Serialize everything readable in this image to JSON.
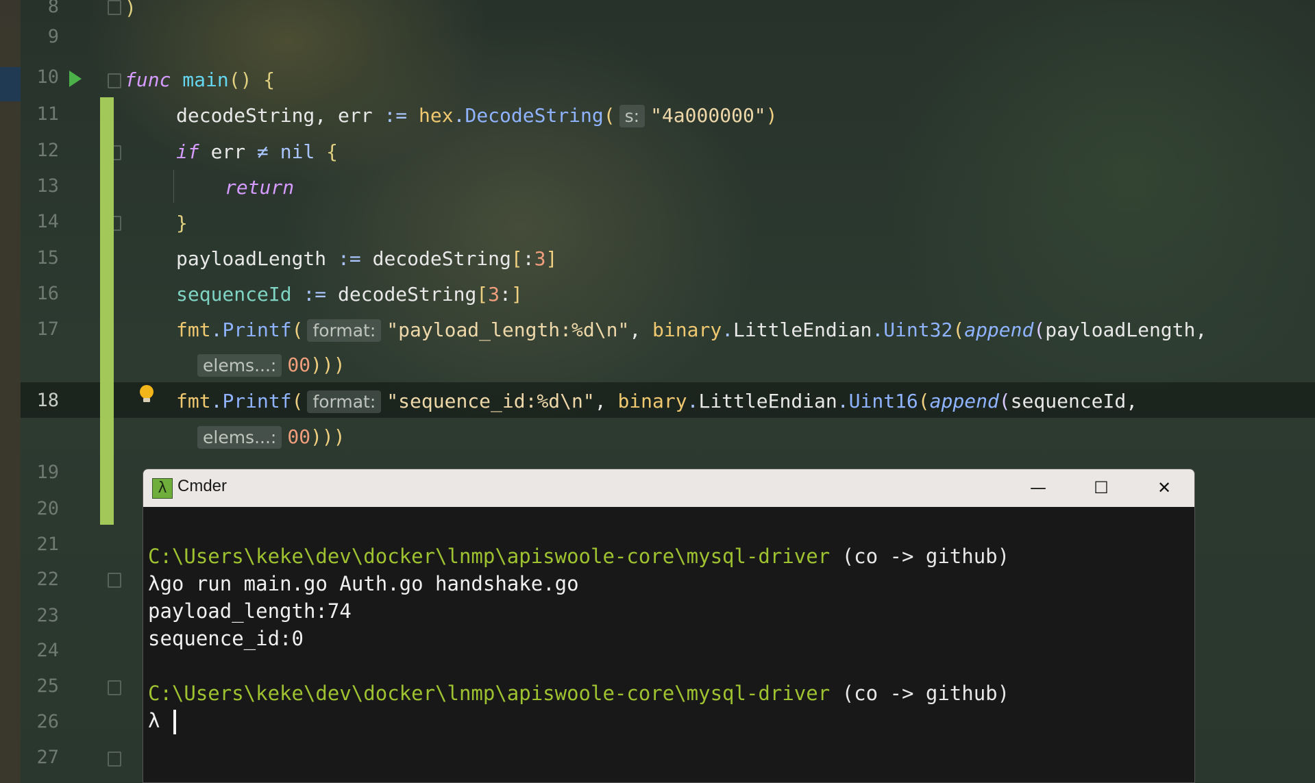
{
  "editor": {
    "line_numbers": [
      "8",
      "9",
      "10",
      "11",
      "12",
      "13",
      "14",
      "15",
      "16",
      "17",
      "18",
      "19",
      "20",
      "21",
      "22",
      "23",
      "24",
      "25",
      "26",
      "27"
    ],
    "lines": {
      "l8_brace": ")",
      "l10": {
        "kw": "func",
        "name": "main",
        "rest": "() {"
      },
      "l11": {
        "a": "decodeString",
        "b": ", err ",
        "op": ":=",
        "pkg": "hex",
        "dot": ".",
        "fn": "DecodeString",
        "open": "(",
        "hint": "s:",
        "str": "\"4a000000\"",
        "close": ")"
      },
      "l12": {
        "kw": "if",
        "b": " err ",
        "op": "≠",
        "nil": " nil ",
        "brace": "{"
      },
      "l13": {
        "kw": "return"
      },
      "l14": {
        "brace": "}"
      },
      "l15": {
        "a": "payloadLength ",
        "op": ":=",
        "b": " decodeString",
        "open": "[",
        "c": ":",
        "num": "3",
        "close": "]"
      },
      "l16": {
        "a": "sequenceId ",
        "op": ":=",
        "b": " decodeString",
        "open": "[",
        "num": "3",
        "c": ":",
        "close": "]"
      },
      "l17": {
        "pkg": "fmt",
        "dot": ".",
        "fn": "Printf",
        "open": "(",
        "hint": "format:",
        "str": "\"payload_length:%d\\n\"",
        "comma": ", ",
        "pkg2": "binary",
        "dot2": ".",
        "cls": "LittleEndian",
        "dot3": ".",
        "fn2": "Uint32",
        "open2": "(",
        "kw": "append",
        "open3": "(",
        "arg": "payloadLength,"
      },
      "l17b": {
        "hint": "elems...:",
        "num": "00",
        "close": ")))"
      },
      "l18": {
        "pkg": "fmt",
        "dot": ".",
        "fn": "Printf",
        "open": "(",
        "hint": "format:",
        "str": "\"sequence_id:%d\\n\"",
        "comma": ", ",
        "pkg2": "binary",
        "dot2": ".",
        "cls": "LittleEndian",
        "dot3": ".",
        "fn2": "Uint16",
        "open2": "(",
        "kw": "append",
        "open3": "(",
        "arg": "sequenceId,"
      },
      "l18b": {
        "hint": "elems...:",
        "num": "00",
        "close": ")))"
      }
    }
  },
  "terminal": {
    "title": "Cmder",
    "logo": "λ",
    "controls": {
      "minimize": "—",
      "maximize": "☐",
      "close": "✕"
    },
    "prompt_path": "C:\\Users\\keke\\dev\\docker\\lnmp\\apiswoole-core\\mysql-driver",
    "prompt_branch": " (co -> github)",
    "prompt_symbol": "λ",
    "command": "go run main.go Auth.go handshake.go",
    "output": [
      "payload_length:74",
      "sequence_id:0"
    ]
  },
  "colors": {
    "vcs_bar": "#a3c85a",
    "run_icon": "#4db14a",
    "bulb": "#f2b51a",
    "terminal_path": "#9fc230"
  }
}
